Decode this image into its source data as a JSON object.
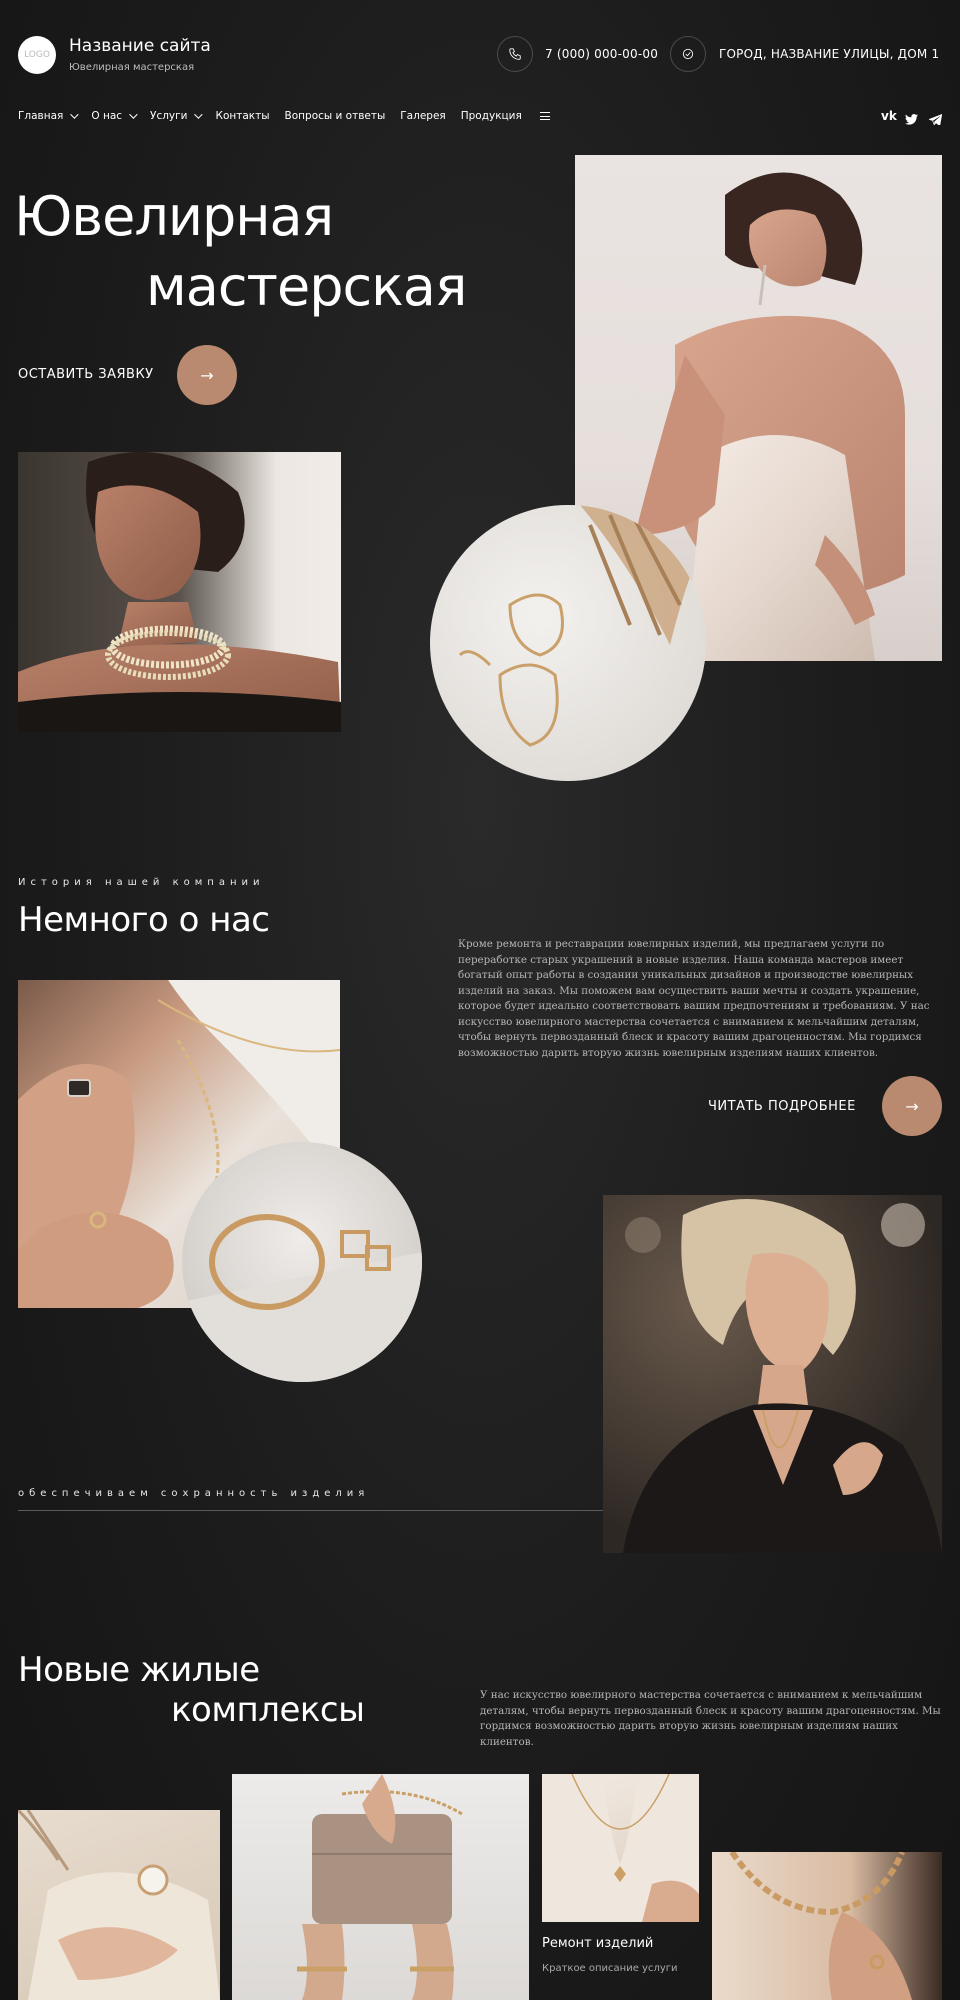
{
  "header": {
    "logo_text": "LOGO",
    "site_name": "Название сайта",
    "site_subtitle": "Ювелирная мастерская",
    "phone": "7 (000) 000-00-00",
    "address": "ГОРОД, НАЗВАНИЕ УЛИЦЫ, ДОМ 1"
  },
  "nav": {
    "items": [
      {
        "label": "Главная",
        "dropdown": true
      },
      {
        "label": "О нас",
        "dropdown": true
      },
      {
        "label": "Услуги",
        "dropdown": true
      },
      {
        "label": "Контакты",
        "dropdown": false
      },
      {
        "label": "Вопросы и ответы",
        "dropdown": false
      },
      {
        "label": "Галерея",
        "dropdown": false
      },
      {
        "label": "Продукция",
        "dropdown": false
      }
    ],
    "social": [
      "vk-icon",
      "twitter-icon",
      "telegram-icon"
    ]
  },
  "hero": {
    "title_line1": "Ювелирная",
    "title_line2": "мастерская",
    "cta_label": "ОСТАВИТЬ ЗАЯВКУ",
    "cta_arrow": "→"
  },
  "about": {
    "eyebrow": "История нашей компании",
    "title": "Немного о нас",
    "text": "Кроме ремонта и реставрации ювелирных изделий, мы предлагаем услуги по переработке старых украшений в новые изделия. Наша команда мастеров имеет богатый опыт работы в создании уникальных дизайнов и производстве ювелирных изделий на заказ. Мы поможем вам осуществить ваши мечты и создать украшение, которое будет идеально соответствовать вашим предпочтениям и требованиям. У нас искусство ювелирного мастерства сочетается с вниманием к мельчайшим деталям, чтобы вернуть первозданный блеск и красоту вашим драгоценностям. Мы гордимся возможностью дарить вторую жизнь ювелирным изделиям наших клиентов.",
    "read_more_label": "ЧИТАТЬ ПОДРОБНЕЕ",
    "read_more_arrow": "→",
    "tagline": "обеспечиваем сохранность изделия"
  },
  "complexes": {
    "title_line1": "Новые жилые",
    "title_line2": "комплексы",
    "text": "У нас искусство ювелирного мастерства сочетается с вниманием к мельчайшим деталям, чтобы вернуть первозданный блеск и красоту вашим драгоценностям. Мы гордимся возможностью дарить вторую жизнь ювелирным изделиям наших клиентов.",
    "card": {
      "title": "Ремонт изделий",
      "description": "Краткое описание услуги"
    }
  },
  "colors": {
    "background": "#1c1c1c",
    "accent": "#b98a6f",
    "text": "#ffffff"
  }
}
